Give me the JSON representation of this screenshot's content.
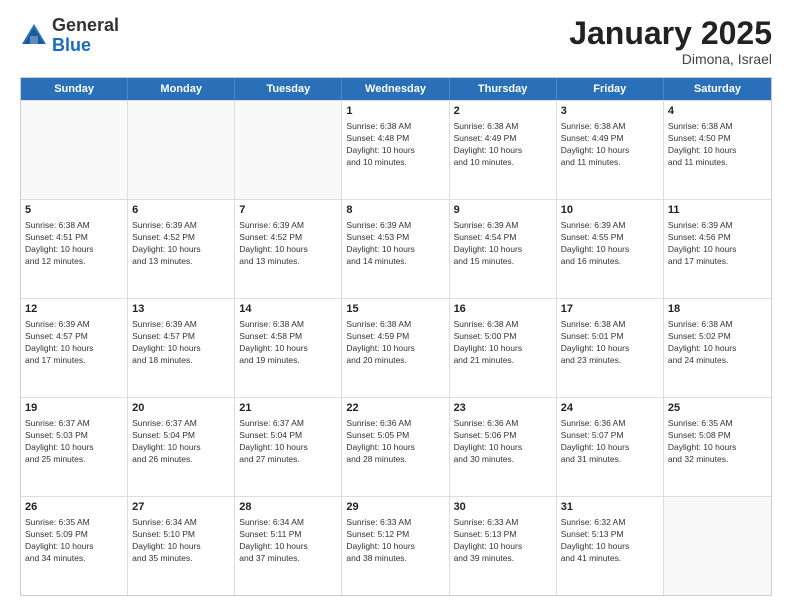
{
  "header": {
    "logo": {
      "general": "General",
      "blue": "Blue"
    },
    "title": "January 2025",
    "location": "Dimona, Israel"
  },
  "days_of_week": [
    "Sunday",
    "Monday",
    "Tuesday",
    "Wednesday",
    "Thursday",
    "Friday",
    "Saturday"
  ],
  "weeks": [
    [
      {
        "day": "",
        "content": ""
      },
      {
        "day": "",
        "content": ""
      },
      {
        "day": "",
        "content": ""
      },
      {
        "day": "1",
        "content": "Sunrise: 6:38 AM\nSunset: 4:48 PM\nDaylight: 10 hours\nand 10 minutes."
      },
      {
        "day": "2",
        "content": "Sunrise: 6:38 AM\nSunset: 4:49 PM\nDaylight: 10 hours\nand 10 minutes."
      },
      {
        "day": "3",
        "content": "Sunrise: 6:38 AM\nSunset: 4:49 PM\nDaylight: 10 hours\nand 11 minutes."
      },
      {
        "day": "4",
        "content": "Sunrise: 6:38 AM\nSunset: 4:50 PM\nDaylight: 10 hours\nand 11 minutes."
      }
    ],
    [
      {
        "day": "5",
        "content": "Sunrise: 6:38 AM\nSunset: 4:51 PM\nDaylight: 10 hours\nand 12 minutes."
      },
      {
        "day": "6",
        "content": "Sunrise: 6:39 AM\nSunset: 4:52 PM\nDaylight: 10 hours\nand 13 minutes."
      },
      {
        "day": "7",
        "content": "Sunrise: 6:39 AM\nSunset: 4:52 PM\nDaylight: 10 hours\nand 13 minutes."
      },
      {
        "day": "8",
        "content": "Sunrise: 6:39 AM\nSunset: 4:53 PM\nDaylight: 10 hours\nand 14 minutes."
      },
      {
        "day": "9",
        "content": "Sunrise: 6:39 AM\nSunset: 4:54 PM\nDaylight: 10 hours\nand 15 minutes."
      },
      {
        "day": "10",
        "content": "Sunrise: 6:39 AM\nSunset: 4:55 PM\nDaylight: 10 hours\nand 16 minutes."
      },
      {
        "day": "11",
        "content": "Sunrise: 6:39 AM\nSunset: 4:56 PM\nDaylight: 10 hours\nand 17 minutes."
      }
    ],
    [
      {
        "day": "12",
        "content": "Sunrise: 6:39 AM\nSunset: 4:57 PM\nDaylight: 10 hours\nand 17 minutes."
      },
      {
        "day": "13",
        "content": "Sunrise: 6:39 AM\nSunset: 4:57 PM\nDaylight: 10 hours\nand 18 minutes."
      },
      {
        "day": "14",
        "content": "Sunrise: 6:38 AM\nSunset: 4:58 PM\nDaylight: 10 hours\nand 19 minutes."
      },
      {
        "day": "15",
        "content": "Sunrise: 6:38 AM\nSunset: 4:59 PM\nDaylight: 10 hours\nand 20 minutes."
      },
      {
        "day": "16",
        "content": "Sunrise: 6:38 AM\nSunset: 5:00 PM\nDaylight: 10 hours\nand 21 minutes."
      },
      {
        "day": "17",
        "content": "Sunrise: 6:38 AM\nSunset: 5:01 PM\nDaylight: 10 hours\nand 23 minutes."
      },
      {
        "day": "18",
        "content": "Sunrise: 6:38 AM\nSunset: 5:02 PM\nDaylight: 10 hours\nand 24 minutes."
      }
    ],
    [
      {
        "day": "19",
        "content": "Sunrise: 6:37 AM\nSunset: 5:03 PM\nDaylight: 10 hours\nand 25 minutes."
      },
      {
        "day": "20",
        "content": "Sunrise: 6:37 AM\nSunset: 5:04 PM\nDaylight: 10 hours\nand 26 minutes."
      },
      {
        "day": "21",
        "content": "Sunrise: 6:37 AM\nSunset: 5:04 PM\nDaylight: 10 hours\nand 27 minutes."
      },
      {
        "day": "22",
        "content": "Sunrise: 6:36 AM\nSunset: 5:05 PM\nDaylight: 10 hours\nand 28 minutes."
      },
      {
        "day": "23",
        "content": "Sunrise: 6:36 AM\nSunset: 5:06 PM\nDaylight: 10 hours\nand 30 minutes."
      },
      {
        "day": "24",
        "content": "Sunrise: 6:36 AM\nSunset: 5:07 PM\nDaylight: 10 hours\nand 31 minutes."
      },
      {
        "day": "25",
        "content": "Sunrise: 6:35 AM\nSunset: 5:08 PM\nDaylight: 10 hours\nand 32 minutes."
      }
    ],
    [
      {
        "day": "26",
        "content": "Sunrise: 6:35 AM\nSunset: 5:09 PM\nDaylight: 10 hours\nand 34 minutes."
      },
      {
        "day": "27",
        "content": "Sunrise: 6:34 AM\nSunset: 5:10 PM\nDaylight: 10 hours\nand 35 minutes."
      },
      {
        "day": "28",
        "content": "Sunrise: 6:34 AM\nSunset: 5:11 PM\nDaylight: 10 hours\nand 37 minutes."
      },
      {
        "day": "29",
        "content": "Sunrise: 6:33 AM\nSunset: 5:12 PM\nDaylight: 10 hours\nand 38 minutes."
      },
      {
        "day": "30",
        "content": "Sunrise: 6:33 AM\nSunset: 5:13 PM\nDaylight: 10 hours\nand 39 minutes."
      },
      {
        "day": "31",
        "content": "Sunrise: 6:32 AM\nSunset: 5:13 PM\nDaylight: 10 hours\nand 41 minutes."
      },
      {
        "day": "",
        "content": ""
      }
    ]
  ]
}
